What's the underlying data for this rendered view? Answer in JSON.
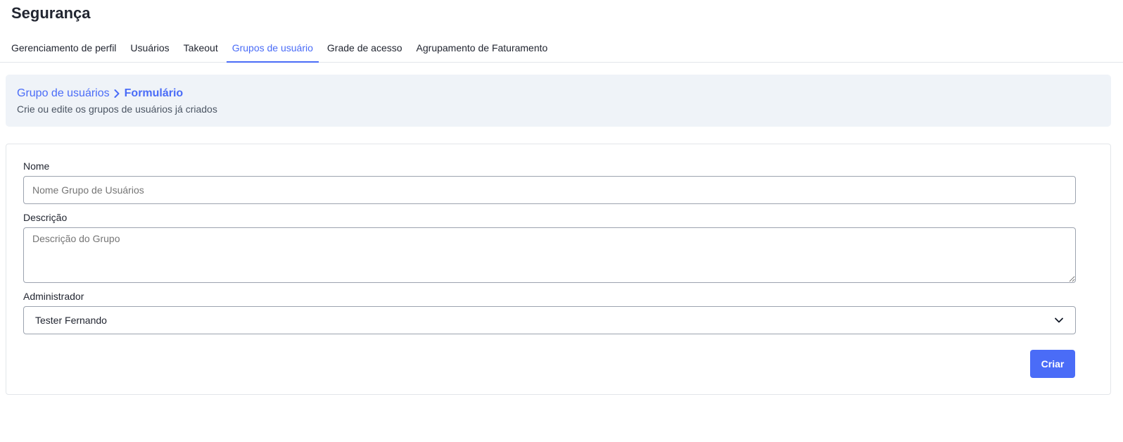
{
  "page": {
    "title": "Segurança"
  },
  "tabs": [
    {
      "label": "Gerenciamento de perfil",
      "active": false
    },
    {
      "label": "Usuários",
      "active": false
    },
    {
      "label": "Takeout",
      "active": false
    },
    {
      "label": "Grupos de usuário",
      "active": true
    },
    {
      "label": "Grade de acesso",
      "active": false
    },
    {
      "label": "Agrupamento de Faturamento",
      "active": false
    }
  ],
  "header": {
    "breadcrumb_parent": "Grupo de usuários",
    "breadcrumb_current": "Formulário",
    "subtitle": "Crie ou edite os grupos de usuários já criados"
  },
  "form": {
    "name_label": "Nome",
    "name_placeholder": "Nome Grupo de Usuários",
    "name_value": "",
    "description_label": "Descrição",
    "description_placeholder": "Descrição do Grupo",
    "description_value": "",
    "admin_label": "Administrador",
    "admin_selected": "Tester Fernando",
    "submit_label": "Criar"
  },
  "icons": {
    "breadcrumb_separator": "chevron-right-icon",
    "select_indicator": "chevron-down-icon"
  },
  "colors": {
    "accent": "#4a6cf7",
    "header_bg": "#eff3f8",
    "text": "#222631",
    "muted": "#4b5563",
    "border": "#9ca3af"
  }
}
